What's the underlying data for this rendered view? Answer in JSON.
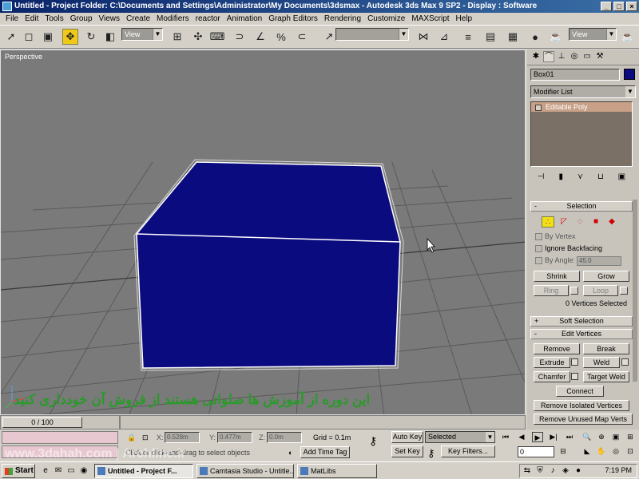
{
  "window": {
    "title": "Untitled    - Project Folder: C:\\Documents and Settings\\Administrator\\My Documents\\3dsmax    - Autodesk 3ds Max 9 SP2    - Display : Software",
    "min": "_",
    "max": "□",
    "close": "×"
  },
  "menu": [
    "File",
    "Edit",
    "Tools",
    "Group",
    "Views",
    "Create",
    "Modifiers",
    "reactor",
    "Animation",
    "Graph Editors",
    "Rendering",
    "Customize",
    "MAXScript",
    "Help"
  ],
  "toolbar": {
    "ref_coord": "View",
    "named_sel": "",
    "view_dd": "View"
  },
  "viewport": {
    "label": "Perspective",
    "overlay_text": "این دوره از آموزش ها صلواتی هستند از فروش آن خودداری کنید",
    "watermark": "www.3dahah.com | Archline.ir",
    "box_color": "#0b0b80",
    "bg_color": "#7a7a7a"
  },
  "command_panel": {
    "object_name": "Box01",
    "object_color": "#0b0b80",
    "modifier_list": "Modifier List",
    "stack_items": [
      "Editable Poly"
    ],
    "selection": {
      "header": "Selection",
      "by_vertex": "By Vertex",
      "ignore_backfacing": "Ignore Backfacing",
      "by_angle": "By Angle:",
      "angle_value": "45.0",
      "shrink": "Shrink",
      "grow": "Grow",
      "ring": "Ring",
      "loop": "Loop",
      "status": "0 Vertices Selected"
    },
    "soft_selection": "Soft Selection",
    "edit_vertices": {
      "header": "Edit Vertices",
      "remove": "Remove",
      "break": "Break",
      "extrude": "Extrude",
      "weld": "Weld",
      "chamfer": "Chamfer",
      "target_weld": "Target Weld",
      "connect": "Connect",
      "remove_isolated": "Remove Isolated Vertices",
      "remove_unused": "Remove Unused Map Verts"
    }
  },
  "timeline": {
    "frame": "0 / 100"
  },
  "status": {
    "x_label": "X:",
    "x_value": "0.528m",
    "y_label": "Y:",
    "y_value": "0.477m",
    "z_label": "Z:",
    "z_value": "0.0m",
    "grid": "Grid = 0.1m",
    "prompt": "Click or click-and-drag to select objects",
    "add_time_tag": "Add Time Tag",
    "auto_key": "Auto Key",
    "selected_dd": "Selected",
    "set_key": "Set Key",
    "key_filters": "Key Filters...",
    "frame_field": "0"
  },
  "taskbar": {
    "start": "Start",
    "tasks": [
      "Untitled    - Project F...",
      "Camtasia Studio - Untitle...",
      "MatLibs"
    ],
    "clock": "7:19 PM"
  }
}
